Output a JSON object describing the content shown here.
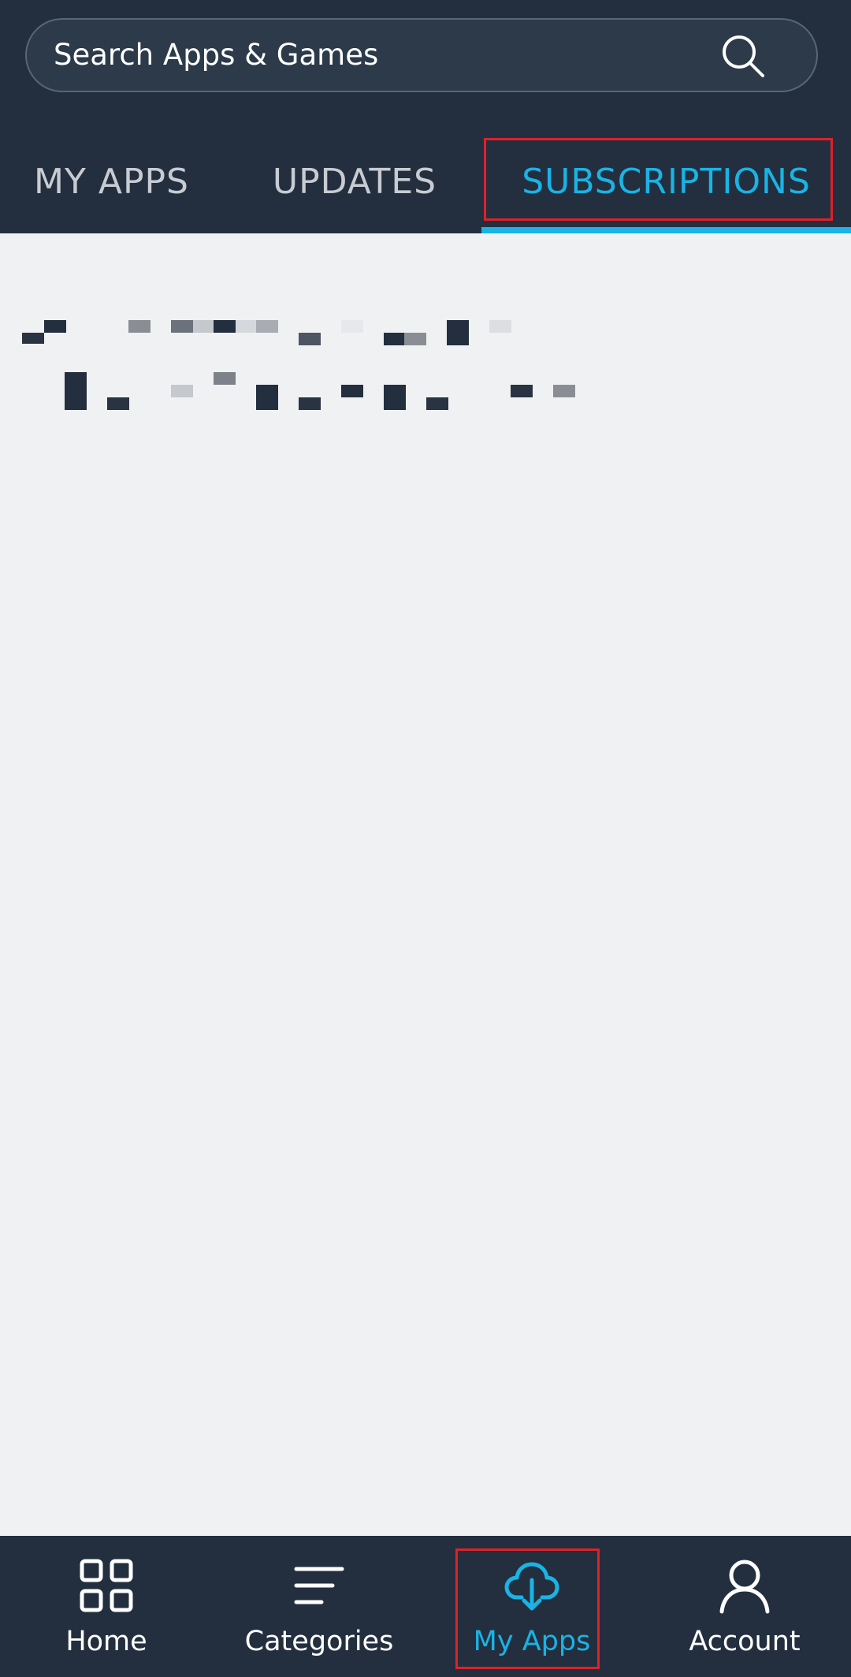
{
  "search": {
    "placeholder": "Search Apps & Games",
    "icon": "search-icon"
  },
  "tabs": [
    {
      "label": "MY APPS",
      "active": false
    },
    {
      "label": "UPDATES",
      "active": false
    },
    {
      "label": "SUBSCRIPTIONS",
      "active": true
    }
  ],
  "bottom_nav": [
    {
      "label": "Home",
      "icon": "grid-icon",
      "active": false
    },
    {
      "label": "Categories",
      "icon": "list-icon",
      "active": false
    },
    {
      "label": "My Apps",
      "icon": "cloud-download-icon",
      "active": true
    },
    {
      "label": "Account",
      "icon": "person-icon",
      "active": false
    }
  ],
  "colors": {
    "header_bg": "#232f3e",
    "accent": "#1ab3e6",
    "content_bg": "#f0f1f2",
    "highlight_box": "#e0202a"
  }
}
